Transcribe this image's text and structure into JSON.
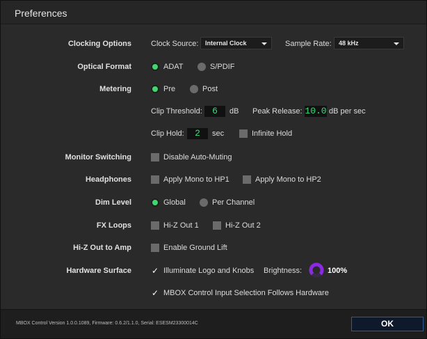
{
  "window": {
    "title": "Preferences"
  },
  "clocking": {
    "label": "Clocking Options",
    "clock_source_label": "Clock Source:",
    "clock_source_value": "Internal Clock",
    "sample_rate_label": "Sample Rate:",
    "sample_rate_value": "48 kHz"
  },
  "optical": {
    "label": "Optical Format",
    "option1": "ADAT",
    "option2": "S/PDIF",
    "selected": "ADAT"
  },
  "metering": {
    "label": "Metering",
    "option1": "Pre",
    "option2": "Post",
    "selected": "Pre",
    "clip_threshold_label": "Clip Threshold:",
    "clip_threshold_value": "6",
    "clip_threshold_unit": "dB",
    "peak_release_label": "Peak Release:",
    "peak_release_value": "10.0",
    "peak_release_unit": "dB per sec",
    "clip_hold_label": "Clip Hold:",
    "clip_hold_value": "2",
    "clip_hold_unit": "sec",
    "infinite_hold_label": "Infinite Hold",
    "infinite_hold_checked": false
  },
  "monitor": {
    "label": "Monitor Switching",
    "option": "Disable Auto-Muting",
    "checked": false
  },
  "headphones": {
    "label": "Headphones",
    "option1": "Apply Mono to HP1",
    "option2": "Apply Mono to HP2"
  },
  "dim": {
    "label": "Dim Level",
    "option1": "Global",
    "option2": "Per Channel",
    "selected": "Global"
  },
  "fx": {
    "label": "FX Loops",
    "option1": "Hi-Z Out 1",
    "option2": "Hi-Z Out 2"
  },
  "hiz": {
    "label": "Hi-Z Out to Amp",
    "option": "Enable Ground Lift"
  },
  "hardware": {
    "label": "Hardware Surface",
    "illuminate_label": "Illuminate Logo and Knobs",
    "illuminate_checked": true,
    "brightness_label": "Brightness:",
    "brightness_value": "100%",
    "brightness_level": 1.0,
    "follow_label": "MBOX Control Input Selection Follows Hardware",
    "follow_checked": true
  },
  "colors": {
    "accent": "#3ed96e",
    "knob": "#8a2be2",
    "ok_border": "#2f5b8f"
  },
  "footer": {
    "info": "MBOX Control Version 1.0.0.1089, Firmware: 0.6.2/1.1.0, Serial: ESESM23300014C",
    "ok_label": "OK"
  }
}
